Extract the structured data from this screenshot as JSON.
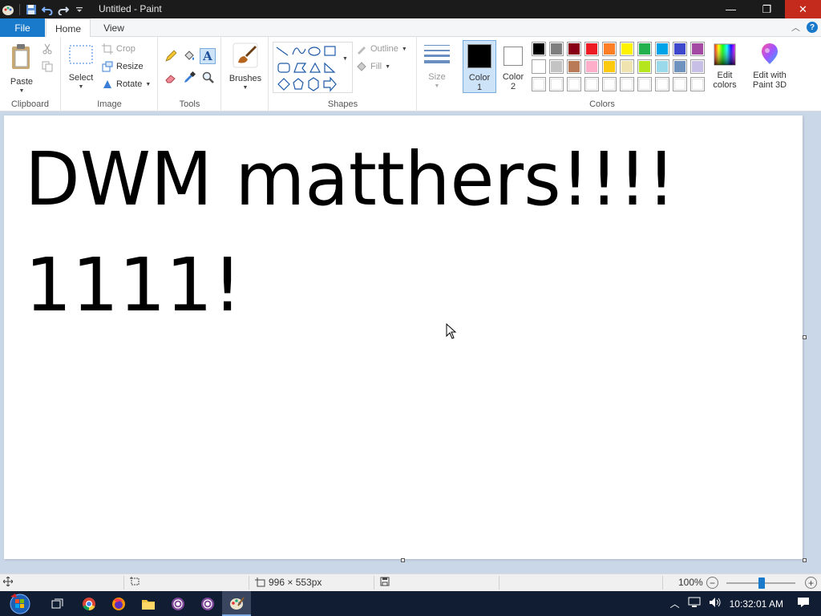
{
  "window": {
    "title": "Untitled - Paint",
    "buttons": {
      "minimize": "—",
      "maximize": "❐",
      "close": "✕"
    }
  },
  "tabs": {
    "file": "File",
    "home": "Home",
    "view": "View"
  },
  "ribbon": {
    "clipboard": {
      "paste": "Paste",
      "label": "Clipboard"
    },
    "image": {
      "select": "Select",
      "crop": "Crop",
      "resize": "Resize",
      "rotate": "Rotate",
      "label": "Image"
    },
    "tools": {
      "label": "Tools"
    },
    "brushes": {
      "label": "Brushes"
    },
    "shapes": {
      "outline": "Outline",
      "fill": "Fill",
      "label": "Shapes"
    },
    "size": {
      "label": "Size"
    },
    "color1": {
      "line1": "Color",
      "line2": "1"
    },
    "color2": {
      "line1": "Color",
      "line2": "2"
    },
    "colors": {
      "label": "Colors"
    },
    "edit_colors": {
      "line1": "Edit",
      "line2": "colors"
    },
    "paint3d": {
      "line1": "Edit with",
      "line2": "Paint 3D"
    }
  },
  "palette": {
    "row1": [
      "#000000",
      "#7f7f7f",
      "#880015",
      "#ed1c24",
      "#ff7f27",
      "#fff200",
      "#22b14c",
      "#00a2e8",
      "#3f48cc",
      "#a349a4"
    ],
    "row2": [
      "#ffffff",
      "#c3c3c3",
      "#b97a57",
      "#ffaec9",
      "#ffc90e",
      "#efe4b0",
      "#b5e61d",
      "#99d9ea",
      "#7092be",
      "#c8bfe7"
    ],
    "row3": [
      "#ffffff",
      "#ffffff",
      "#ffffff",
      "#ffffff",
      "#ffffff",
      "#ffffff",
      "#ffffff",
      "#ffffff",
      "#ffffff",
      "#ffffff"
    ],
    "color1": "#000000",
    "color2": "#ffffff"
  },
  "canvas": {
    "line1": "DWM matthers!!!!",
    "line2": "1111!"
  },
  "status": {
    "image_size": "996 × 553px",
    "zoom": "100%"
  },
  "taskbar": {
    "time": "10:32:01 AM"
  }
}
